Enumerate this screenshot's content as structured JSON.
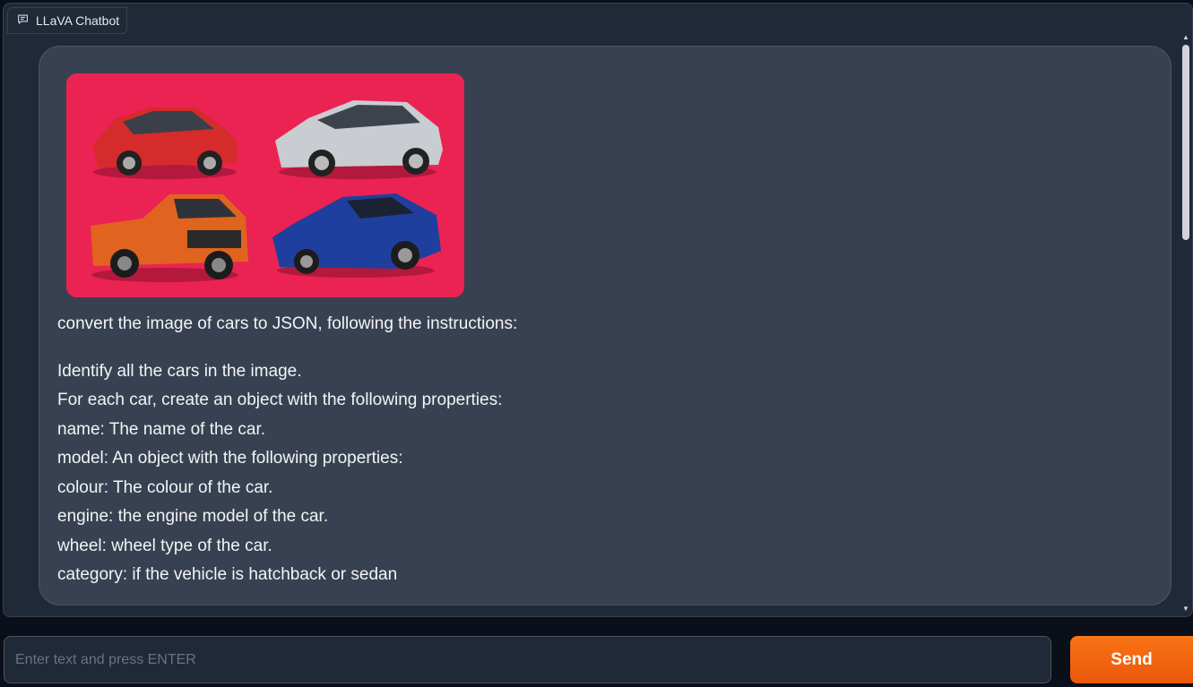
{
  "chatbot": {
    "label": "LLaVA Chatbot",
    "icon": "chat-icon"
  },
  "message": {
    "image_alt": "Four cars: a red hatchback, a silver sedan, an orange pickup truck and a blue coupe on a pink background",
    "lines": [
      "convert the image of cars to JSON, following the instructions:",
      "Identify all the cars in the image.",
      "For each car, create an object with the following properties:",
      "name: The name of the car.",
      "model: An object with the following properties:",
      "colour: The colour of the car.",
      "engine: the engine model of the car.",
      "wheel: wheel type of the car.",
      "category: if the vehicle is hatchback or sedan"
    ]
  },
  "input": {
    "placeholder": "Enter text and press ENTER",
    "value": ""
  },
  "send": {
    "label": "Send"
  },
  "colors": {
    "background": "#0b0f19",
    "panel": "#1f2937",
    "bubble": "#374151",
    "accent": "#f97316",
    "image_bg": "#eb2352"
  }
}
